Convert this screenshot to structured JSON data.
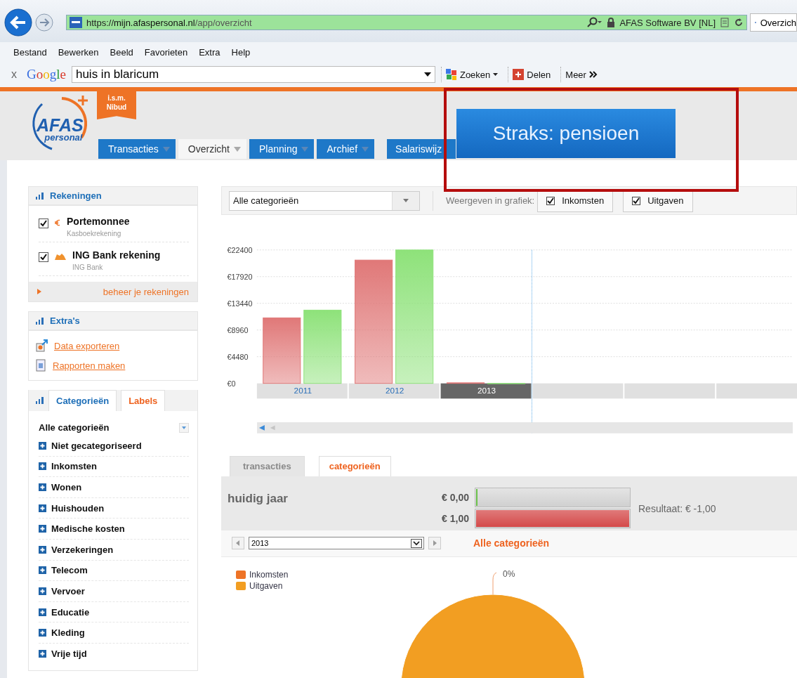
{
  "browser": {
    "address": {
      "protocol": "https://",
      "host": "mijn.afaspersonal.nl",
      "path": "/app/overzicht"
    },
    "site_identity": "AFAS Software BV [NL]",
    "tab_title": "Overzich",
    "menu": [
      "Bestand",
      "Bewerken",
      "Beeld",
      "Favorieten",
      "Extra",
      "Help"
    ],
    "toolbar": {
      "close": "x",
      "logo": "Google",
      "search_value": "huis in blaricum",
      "buttons": [
        {
          "label": "Zoeken",
          "kind": "search"
        },
        {
          "label": "Delen",
          "kind": "share"
        },
        {
          "label": "Meer",
          "kind": "more"
        }
      ]
    }
  },
  "header": {
    "logo": {
      "name": "AFAS",
      "sub": "personal"
    },
    "ribbon": [
      "i.s.m.",
      "Nibud"
    ],
    "nav": [
      {
        "label": "Transacties",
        "selected": false,
        "has_menu": true
      },
      {
        "label": "Overzicht",
        "selected": true,
        "has_menu": true
      },
      {
        "label": "Planning",
        "selected": false,
        "has_menu": true
      },
      {
        "label": "Archief",
        "selected": false,
        "has_menu": true
      },
      {
        "label": "Salariswijz",
        "selected": false,
        "has_menu": false
      }
    ],
    "promo_banner": "Straks: pensioen"
  },
  "sidebar": {
    "accounts": {
      "title": "Rekeningen",
      "items": [
        {
          "name": "Portemonnee",
          "type": "Kasboekrekening",
          "checked": true,
          "kind": "cash"
        },
        {
          "name": "ING Bank rekening",
          "type": "ING Bank",
          "checked": true,
          "kind": "bank"
        }
      ],
      "footer_link": "beheer je rekeningen"
    },
    "extras": {
      "title": "Extra's",
      "links": [
        {
          "label": "Data exporteren",
          "kind": "export"
        },
        {
          "label": "Rapporten maken",
          "kind": "report"
        }
      ]
    },
    "categories": {
      "tabs": [
        {
          "label": "Categorieën",
          "selected": true
        },
        {
          "label": "Labels",
          "selected": false
        }
      ],
      "heading": "Alle categorieën",
      "items": [
        {
          "label": "Niet gecategoriseerd",
          "expanded": false
        },
        {
          "label": "Inkomsten",
          "expanded": false
        },
        {
          "label": "Wonen",
          "expanded": false
        },
        {
          "label": "Huishouden",
          "expanded": false
        },
        {
          "label": "Medische kosten",
          "expanded": false
        },
        {
          "label": "Verzekeringen",
          "expanded": false
        },
        {
          "label": "Telecom",
          "expanded": false
        },
        {
          "label": "Vervoer",
          "expanded": false
        },
        {
          "label": "Educatie",
          "expanded": false
        },
        {
          "label": "Kleding",
          "expanded": false
        },
        {
          "label": "Vrije tijd",
          "expanded": false
        }
      ]
    }
  },
  "filter": {
    "category_select": "Alle categorieën",
    "label": "Weergeven in grafiek:",
    "toggles": [
      {
        "label": "Inkomsten",
        "checked": true
      },
      {
        "label": "Uitgaven",
        "checked": true
      }
    ]
  },
  "overview_chart": {
    "category_selected": [
      false,
      false,
      true
    ],
    "chart_data": {
      "type": "bar",
      "categories": [
        "2011",
        "2012",
        "2013"
      ],
      "series": [
        {
          "color": "#e07878",
          "values": [
            11000,
            20700,
            100
          ]
        },
        {
          "color": "#8ee27a",
          "values": [
            12300,
            22400,
            0
          ]
        }
      ],
      "grid": true,
      "ylim": [
        0,
        22400
      ],
      "yticks": [
        {
          "value": 0,
          "label": "€0"
        },
        {
          "value": 4480,
          "label": "€4480"
        },
        {
          "value": 8960,
          "label": "€8960"
        },
        {
          "value": 13440,
          "label": "€13440"
        },
        {
          "value": 17920,
          "label": "€17920"
        },
        {
          "value": 22400,
          "label": "€22400"
        }
      ]
    }
  },
  "detail": {
    "tabs": [
      {
        "label": "transacties",
        "selected": false
      },
      {
        "label": "categorieën",
        "selected": true
      }
    ],
    "summary": {
      "title": "huidig jaar",
      "bars": [
        {
          "amount": "€ 0,00",
          "level": 0,
          "kind": "income"
        },
        {
          "amount": "€ 1,00",
          "level": 1,
          "kind": "expense"
        }
      ],
      "result": "Resultaat: € -1,00"
    },
    "year_select": "2013",
    "category_heading": "Alle categorieën",
    "pie": {
      "legend": [
        {
          "color": "#ee7326"
        },
        {
          "color": "#f29e22"
        }
      ],
      "chart_data": {
        "type": "pie",
        "categories": [
          "Inkomsten",
          "Uitgaven"
        ],
        "values": [
          0,
          1
        ],
        "annotations": [
          "0%"
        ]
      }
    }
  }
}
